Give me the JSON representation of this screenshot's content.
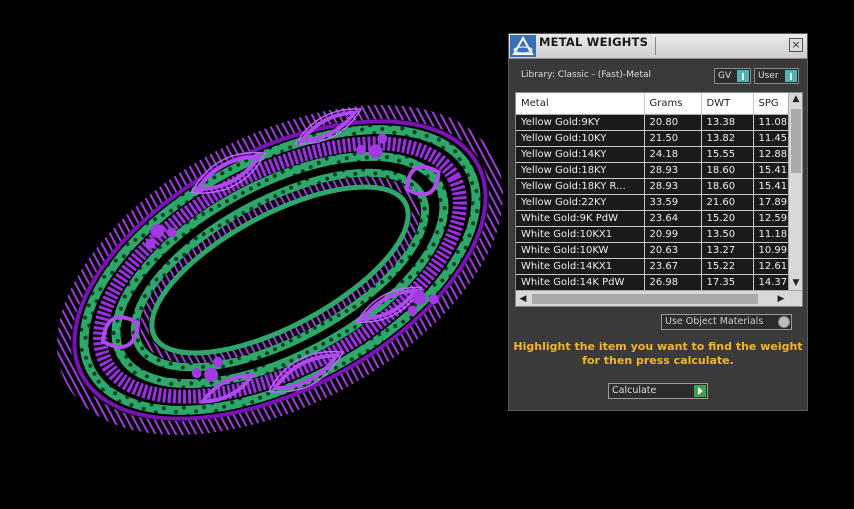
{
  "viewport": {
    "object": "bangle-3d-model-render",
    "colors": {
      "setting": "#8a1fc4",
      "band": "#2ea86a"
    }
  },
  "panel": {
    "title": "METAL WEIGHTS",
    "close_icon": "×",
    "library_label": "Library: Classic - (Fast)-Metal",
    "toggle_gv": "GV",
    "toggle_user": "User",
    "table": {
      "columns": [
        "Metal",
        "Grams",
        "DWT",
        "SPG"
      ],
      "rows": [
        [
          "Yellow Gold:9KY",
          "20.80",
          "13.38",
          "11.08"
        ],
        [
          "Yellow Gold:10KY",
          "21.50",
          "13.82",
          "11.45"
        ],
        [
          "Yellow Gold:14KY",
          "24.18",
          "15.55",
          "12.88"
        ],
        [
          "Yellow Gold:18KY",
          "28.93",
          "18.60",
          "15.41"
        ],
        [
          "Yellow Gold:18KY R...",
          "28.93",
          "18.60",
          "15.41"
        ],
        [
          "Yellow Gold:22KY",
          "33.59",
          "21.60",
          "17.89"
        ],
        [
          "White Gold:9K PdW",
          "23.64",
          "15.20",
          "12.59"
        ],
        [
          "White Gold:10KX1",
          "20.99",
          "13.50",
          "11.18"
        ],
        [
          "White Gold:10KW",
          "20.63",
          "13.27",
          "10.99"
        ],
        [
          "White Gold:14KX1",
          "23.67",
          "15.22",
          "12.61"
        ],
        [
          "White Gold:14K PdW",
          "26.98",
          "17.35",
          "14.37"
        ]
      ]
    },
    "use_object_materials": "Use Object Materials",
    "instructions_line1": "Highlight the item you want to find the weight",
    "instructions_line2": "for then press calculate.",
    "calculate_label": "Calculate",
    "accent_color": "#f2b624"
  }
}
